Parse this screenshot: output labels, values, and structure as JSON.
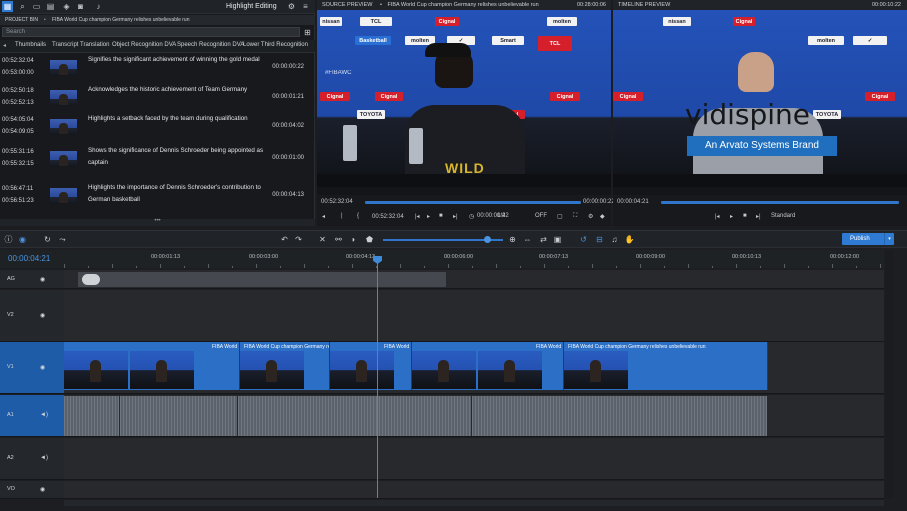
{
  "header": {
    "title": "Highlight Editing"
  },
  "project_bin": {
    "label": "PROJECT BIN",
    "title": "FIBA World Cup champion Germany relishes unbelievable run",
    "search_placeholder": "Search"
  },
  "tabs": [
    "Thumbnails",
    "Transcript Translation",
    "Object Recognition DVA",
    "Speech Recognition DVA",
    "Lower Third Recognition"
  ],
  "bin_items": [
    {
      "in": "00:52:32:04",
      "out": "00:53:00:00",
      "desc": "Signifies the significant achievement of winning the gold medal",
      "dur": "00:00:00:22"
    },
    {
      "in": "00:52:50:18",
      "out": "00:52:52:13",
      "desc": "Acknowledges the historic achievement of Team Germany",
      "dur": "00:00:01:21"
    },
    {
      "in": "00:54:05:04",
      "out": "00:54:09:05",
      "desc": "Highlights a setback faced by the team during qualification",
      "dur": "00:00:04:02"
    },
    {
      "in": "00:55:31:16",
      "out": "00:55:32:15",
      "desc": "Shows the significance of Dennis Schroeder being appointed as captain",
      "dur": "00:00:01:00"
    },
    {
      "in": "00:56:47:11",
      "out": "00:56:51:23",
      "desc": "Highlights the importance of Dennis Schroeder's contribution to German basketball",
      "dur": "00:00:04:13"
    }
  ],
  "source": {
    "label": "SOURCE PREVIEW",
    "title": "FIBA World Cup champion Germany relishes unbelievable run",
    "tc_top": "00:28:00:06",
    "tc": "00:52:32:04",
    "zoom": "1/4",
    "tc_mid": "00:00:00:22",
    "audio": "OFF"
  },
  "timeline_preview": {
    "label": "TIMELINE PREVIEW",
    "tc_top": "00:00:10:22",
    "tc": "00:00:04:21",
    "overlay_word": "vidispine",
    "overlay_brand": "An Arvato Systems Brand",
    "mode": "Standard"
  },
  "logos": [
    "Smart",
    "TCL",
    "molten",
    "Cignal",
    "TOYOTA",
    "#FIBAWC",
    "nissan",
    "Basketball"
  ],
  "timeline": {
    "current": "00:00:04:21",
    "publish": "Publish",
    "ruler": [
      "00:00:01:13",
      "00:00:03:00",
      "00:00:04:13",
      "00:00:06:00",
      "00:00:07:13",
      "00:00:09:00",
      "00:00:10:13",
      "00:00:12:00"
    ],
    "tracks": [
      "AG",
      "V2",
      "V1",
      "A1",
      "A2",
      "VO"
    ],
    "clip_title": "FIBA World Cup champion Germany relishes unbelievable run",
    "clip_short": "FIBA World"
  },
  "colors": {
    "accent": "#2f7bd4",
    "active_track": "#1e5ca8",
    "clip": "#2c6fc6"
  }
}
